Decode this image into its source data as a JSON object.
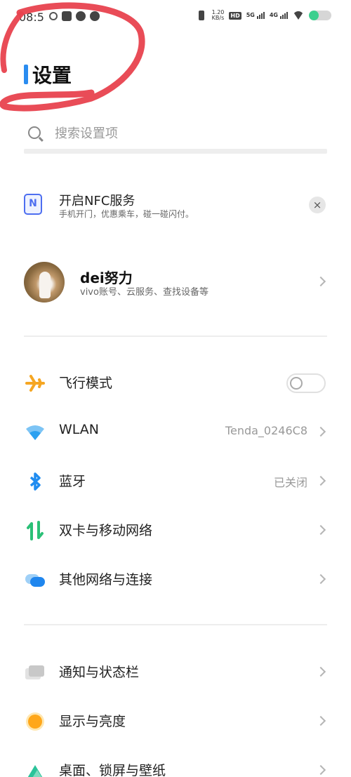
{
  "status_bar": {
    "time": "08:5",
    "speed_value": "1.20",
    "speed_unit": "KB/s",
    "hd_label": "HD",
    "net1": "5G",
    "net2": "4G",
    "battery_level": 0.45
  },
  "header": {
    "title": "设置"
  },
  "search": {
    "placeholder": "搜索设置项"
  },
  "nfc_card": {
    "title": "开启NFC服务",
    "description": "手机开门，优惠乘车，碰一碰闪付。",
    "close_icon": "×"
  },
  "account": {
    "name": "dei努力",
    "description": "vivo账号、云服务、查找设备等"
  },
  "settings": [
    {
      "id": "airplane",
      "label": "飞行模式",
      "icon": "airplane-icon",
      "toggle": false
    },
    {
      "id": "wlan",
      "label": "WLAN",
      "icon": "wifi-icon",
      "value": "Tenda_0246C8"
    },
    {
      "id": "bluetooth",
      "label": "蓝牙",
      "icon": "bluetooth-icon",
      "value": "已关闭"
    },
    {
      "id": "sim",
      "label": "双卡与移动网络",
      "icon": "sim-network-icon"
    },
    {
      "id": "other-network",
      "label": "其他网络与连接",
      "icon": "connection-icon"
    },
    {
      "id": "notifications",
      "label": "通知与状态栏",
      "icon": "notification-icon"
    },
    {
      "id": "display",
      "label": "显示与亮度",
      "icon": "display-icon"
    },
    {
      "id": "desktop",
      "label": "桌面、锁屏与壁纸",
      "icon": "wallpaper-icon"
    }
  ],
  "colors": {
    "accent": "#2a8cf0",
    "airplane": "#f5a623",
    "wifi": "#2aa0f0",
    "bluetooth": "#1f8cf0",
    "sim": "#2bc077",
    "connection": "#2b8cf0",
    "display": "#ffa71a",
    "wallpaper": "#2bc39a",
    "annotation": "#e8424e"
  }
}
